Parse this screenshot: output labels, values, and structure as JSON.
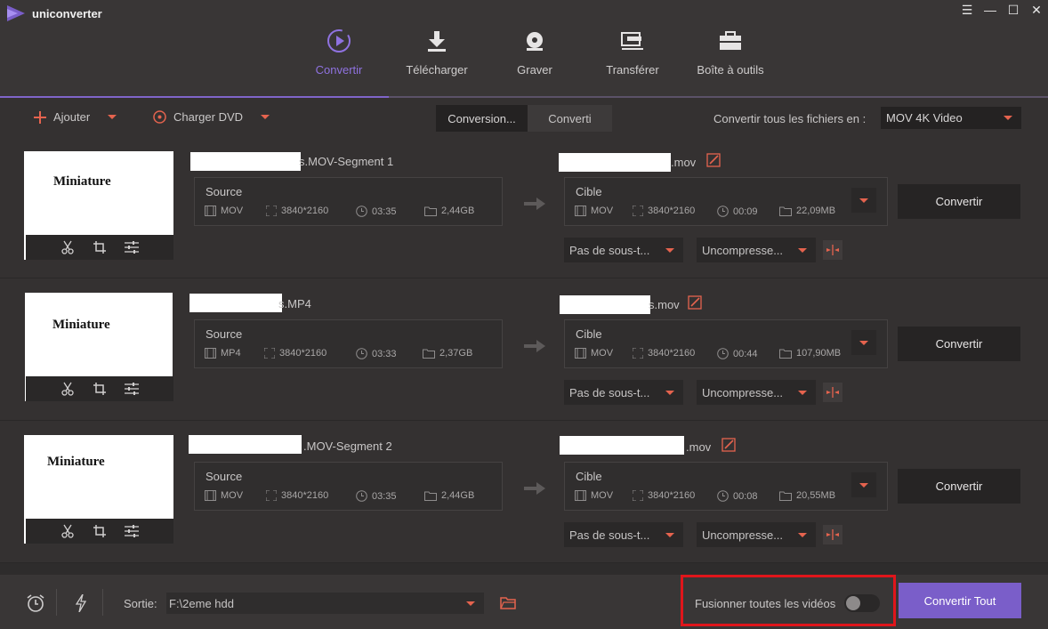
{
  "app": {
    "title": "uniconverter"
  },
  "window": {
    "menu_glyph": "☰",
    "minimize_glyph": "—",
    "maximize_glyph": "☐",
    "close_glyph": "✕"
  },
  "nav": [
    {
      "label": "Convertir",
      "icon": "convert-icon",
      "active": true
    },
    {
      "label": "Télécharger",
      "icon": "download-icon",
      "active": false
    },
    {
      "label": "Graver",
      "icon": "burn-disc-icon",
      "active": false
    },
    {
      "label": "Transférer",
      "icon": "transfer-icon",
      "active": false
    },
    {
      "label": "Boîte à outils",
      "icon": "toolbox-icon",
      "active": false
    }
  ],
  "toolbar": {
    "add_label": "Ajouter",
    "load_dvd_label": "Charger DVD",
    "tab_converting": "Conversion...",
    "tab_converted": "Converti",
    "convert_all_label": "Convertir tous les fichiers en :",
    "format_value": "MOV 4K Video"
  },
  "colors": {
    "accent": "#7a5ec9",
    "orange": "#e5634e",
    "highlight_box": "#e0151b"
  },
  "files": [
    {
      "thumb_label": "Miniature",
      "source_name_suffix": "s.MOV-Segment 1",
      "target_name_suffix": ".mov",
      "source": {
        "title": "Source",
        "format": "MOV",
        "resolution": "3840*2160",
        "duration": "03:35",
        "size": "2,44GB"
      },
      "target": {
        "title": "Cible",
        "format": "MOV",
        "resolution": "3840*2160",
        "duration": "00:09",
        "size": "22,09MB"
      },
      "subtitle": "Pas de sous-t...",
      "audio": "Uncompresse...",
      "convert_label": "Convertir"
    },
    {
      "thumb_label": "Miniature",
      "source_name_suffix": "s.MP4",
      "target_name_suffix": "s.mov",
      "source": {
        "title": "Source",
        "format": "MP4",
        "resolution": "3840*2160",
        "duration": "03:33",
        "size": "2,37GB"
      },
      "target": {
        "title": "Cible",
        "format": "MOV",
        "resolution": "3840*2160",
        "duration": "00:44",
        "size": "107,90MB"
      },
      "subtitle": "Pas de sous-t...",
      "audio": "Uncompresse...",
      "convert_label": "Convertir"
    },
    {
      "thumb_label": "Miniature",
      "source_name_suffix": ".MOV-Segment 2",
      "target_name_suffix": ".mov",
      "source": {
        "title": "Source",
        "format": "MOV",
        "resolution": "3840*2160",
        "duration": "03:35",
        "size": "2,44GB"
      },
      "target": {
        "title": "Cible",
        "format": "MOV",
        "resolution": "3840*2160",
        "duration": "00:08",
        "size": "20,55MB"
      },
      "subtitle": "Pas de sous-t...",
      "audio": "Uncompresse...",
      "convert_label": "Convertir"
    }
  ],
  "bottom": {
    "output_label": "Sortie:",
    "output_path": "F:\\2eme hdd",
    "merge_label": "Fusionner toutes les vidéos",
    "merge_enabled": false,
    "convert_all_button": "Convertir Tout"
  }
}
